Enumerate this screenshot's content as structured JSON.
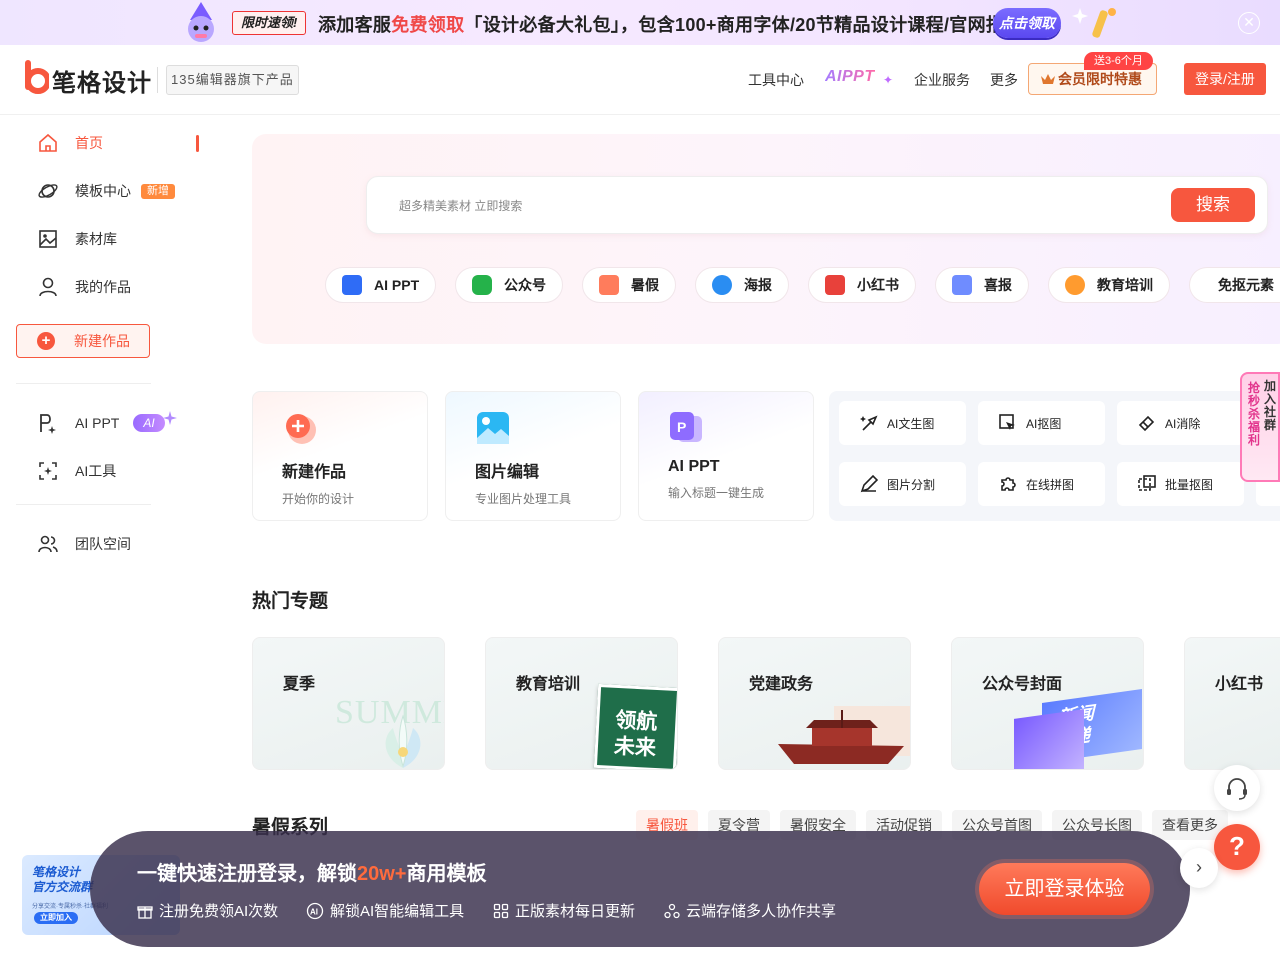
{
  "banner": {
    "tag": "限时速领!",
    "text_before": "添加客服",
    "text_highlight": "免费领取",
    "text_after": "「设计必备大礼包」，包含100+商用字体/20节精品设计课程/官网指定模板",
    "button": "点击领取",
    "close": "✕"
  },
  "header": {
    "logo": "笔格设计",
    "sub_product": "135编辑器旗下产品",
    "nav": [
      "工具中心",
      "AIPPT",
      "企业服务",
      "更多"
    ],
    "aippt_spark": "✦",
    "vip_label": "会员限时特惠",
    "vip_badge": "送3-6个月",
    "login": "登录/注册"
  },
  "sidebar": {
    "items": [
      {
        "label": "首页",
        "icon": "home-icon"
      },
      {
        "label": "模板中心",
        "icon": "planet-icon",
        "badge": "新增"
      },
      {
        "label": "素材库",
        "icon": "image-icon"
      },
      {
        "label": "我的作品",
        "icon": "user-icon"
      }
    ],
    "new_work": "新建作品",
    "ai_items": [
      {
        "label": "AI PPT",
        "icon": "p-ai-icon",
        "badge": "AI"
      },
      {
        "label": "AI工具",
        "icon": "scan-icon"
      }
    ],
    "team": "团队空间"
  },
  "search": {
    "placeholder": "超多精美素材 立即搜索",
    "button": "搜索"
  },
  "chips": [
    {
      "label": "AI PPT",
      "color": "#2f6cf6"
    },
    {
      "label": "公众号",
      "color": "#25b24a"
    },
    {
      "label": "暑假",
      "color": "#ff7c5c"
    },
    {
      "label": "海报",
      "color": "#2a8df2"
    },
    {
      "label": "小红书",
      "color": "#e8413b"
    },
    {
      "label": "喜报",
      "color": "#6f8cff"
    },
    {
      "label": "教育培训",
      "color": "#ff9b2f"
    },
    {
      "label": "免抠元素",
      "color": "#ffc21d"
    }
  ],
  "feature_cards": [
    {
      "title": "新建作品",
      "desc": "开始你的设计"
    },
    {
      "title": "图片编辑",
      "desc": "专业图片处理工具"
    },
    {
      "title": "AI PPT",
      "desc": "输入标题一键生成"
    }
  ],
  "tools": [
    "AI文生图",
    "AI抠图",
    "AI消除",
    "图片分割",
    "在线拼图",
    "批量抠图"
  ],
  "hot_topics": {
    "title": "热门专题",
    "items": [
      "夏季",
      "教育培训",
      "党建政务",
      "公众号封面",
      "小红书"
    ],
    "decor_text": [
      "SUMME",
      "领航",
      "未来",
      "新闻",
      "速递"
    ]
  },
  "summer_series": {
    "title": "暑假系列",
    "tags": [
      "暑假班",
      "夏令营",
      "暑假安全",
      "活动促销",
      "公众号首图",
      "公众号长图",
      "查看更多"
    ]
  },
  "float": {
    "group_vertical": "加入社群",
    "group_vertical2": "抢秒杀福利",
    "help": "?",
    "next": "›",
    "wx_line1": "笔格设计",
    "wx_line2": "官方交流群",
    "wx_line3": "分享交流·专属秒杀·社群福利",
    "wx_btn": "立即加入"
  },
  "login_bar": {
    "headline_before": "一键快速注册登录，解锁",
    "headline_highlight": "20w+",
    "headline_after": "商用模板",
    "perks": [
      "注册免费领AI次数",
      "解锁AI智能编辑工具",
      "正版素材每日更新",
      "云端存储多人协作共享"
    ],
    "button": "立即登录体验"
  },
  "colors": {
    "brand": "#f7573e",
    "ai_purple": "#9a6bff"
  }
}
